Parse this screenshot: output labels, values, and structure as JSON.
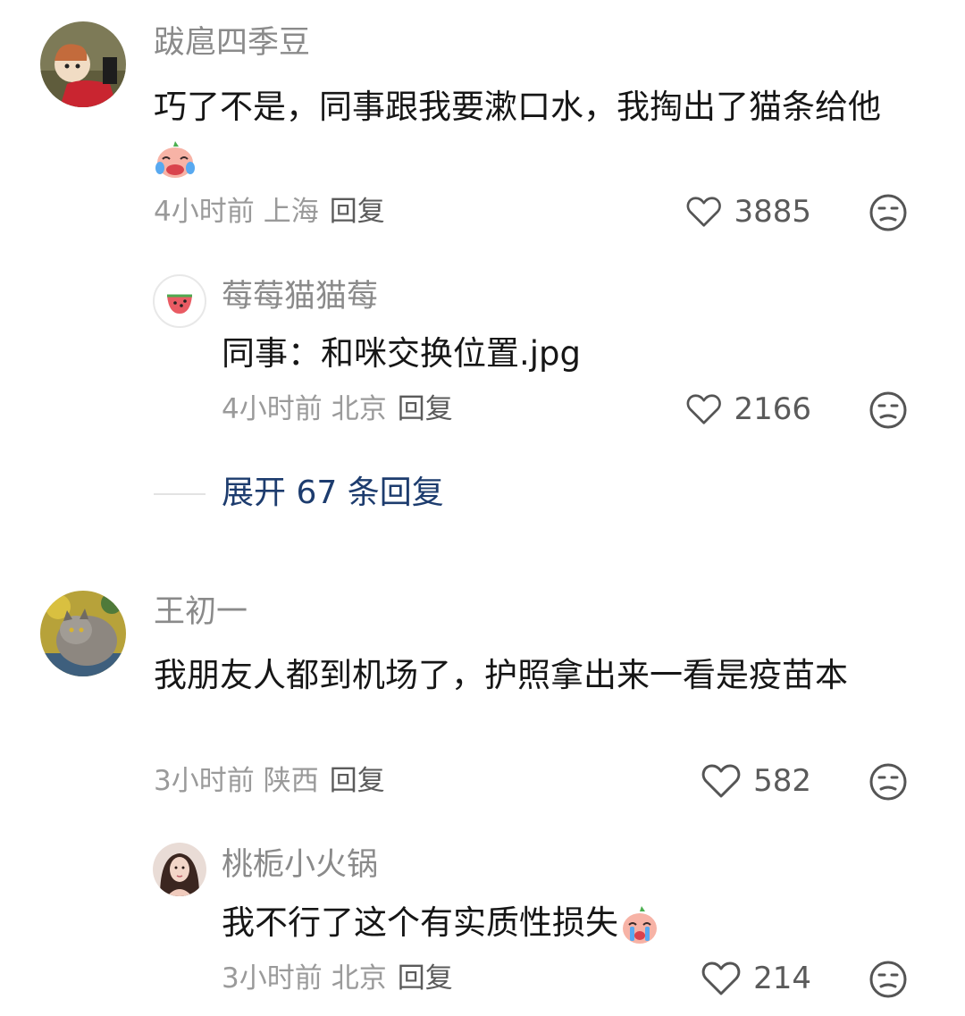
{
  "comments": [
    {
      "username": "跋扈四季豆",
      "text": "巧了不是，同事跟我要漱口水，我掏出了猫条给他",
      "emoji": "crying-laugh-peach-emoji",
      "time": "4小时前",
      "location": "上海",
      "reply_label": "回复",
      "likes": "3885",
      "replies": [
        {
          "username": "莓莓猫猫莓",
          "text": "同事：和咪交换位置.jpg",
          "time": "4小时前",
          "location": "北京",
          "reply_label": "回复",
          "likes": "2166"
        }
      ],
      "expand_label": "展开 67 条回复"
    },
    {
      "username": "王初一",
      "text": "我朋友人都到机场了，护照拿出来一看是疫苗本",
      "time": "3小时前",
      "location": "陕西",
      "reply_label": "回复",
      "likes": "582",
      "replies": [
        {
          "username": "桃栀小火锅",
          "text": "我不行了这个有实质性损失",
          "emoji": "crying-peach-emoji",
          "time": "3小时前",
          "location": "北京",
          "reply_label": "回复",
          "likes": "214"
        }
      ]
    }
  ],
  "icons": {
    "like": "heart-outline-icon",
    "dislike": "meh-face-icon"
  },
  "colors": {
    "expand_text": "#1d3c6e",
    "meta_text": "#9a9a9a",
    "username": "#8a8a8a"
  }
}
